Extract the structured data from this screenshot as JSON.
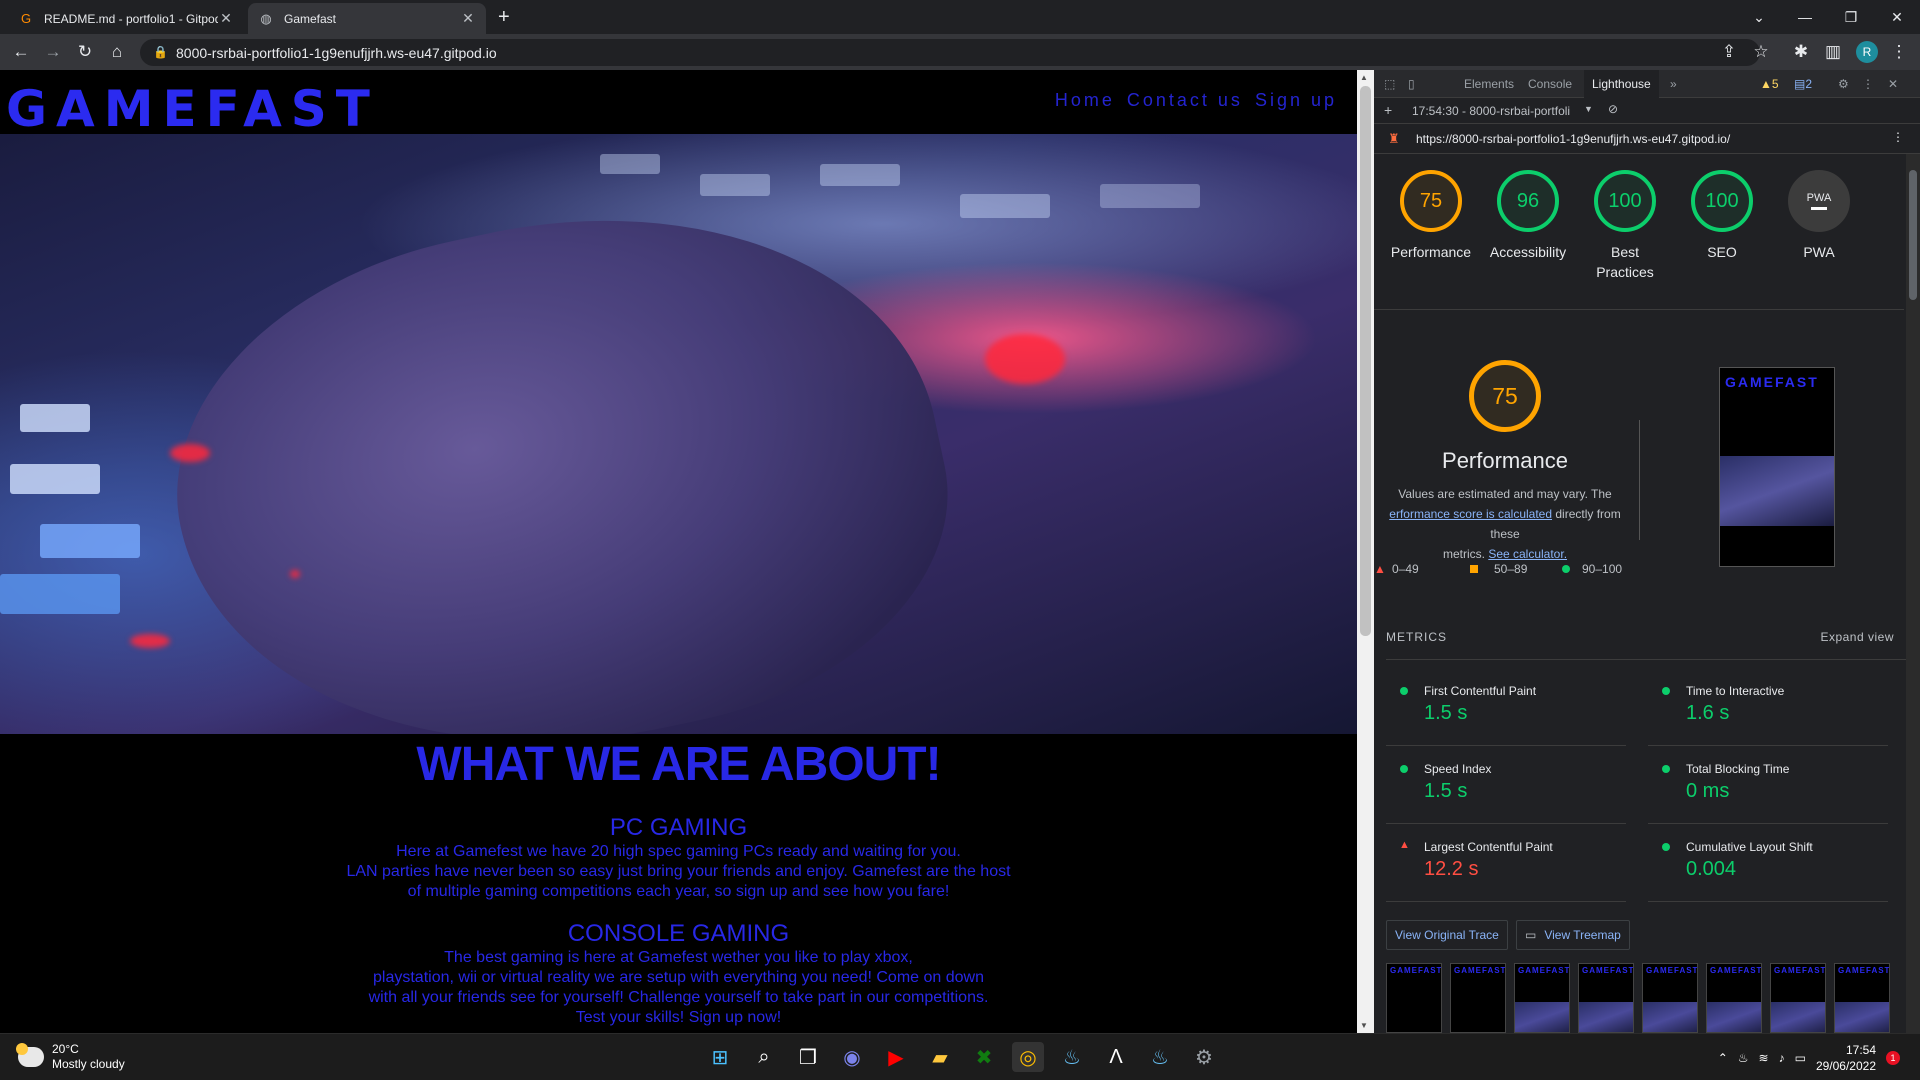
{
  "browser": {
    "tabs": [
      {
        "title": "README.md - portfolio1 - Gitpod",
        "active": false
      },
      {
        "title": "Gamefast",
        "active": true
      }
    ],
    "address": "8000-rsrbai-portfolio1-1g9enufjjrh.ws-eu47.gitpod.io",
    "profile_initial": "R"
  },
  "site": {
    "logo": "GAMEFAST",
    "nav": [
      "Home",
      "Contact us",
      "Sign up"
    ],
    "about_title": "WHAT WE ARE ABOUT!",
    "sections": [
      {
        "heading": "PC GAMING",
        "lines": [
          "Here at Gamefest we have 20 high spec gaming PCs ready and waiting for you.",
          "LAN parties have never been so easy just bring your friends and enjoy. Gamefest are the host",
          "of multiple gaming competitions each year, so sign up and see how you fare!"
        ]
      },
      {
        "heading": "CONSOLE GAMING",
        "lines": [
          "The best gaming is here at Gamefest wether you like to play xbox,",
          "playstation, wii or virtual reality we are setup with everything you need! Come on down",
          "with all your friends see for yourself! Challenge yourself to take part in our competitions.",
          "Test your skills! Sign up now!"
        ]
      }
    ],
    "accent_color": "#2828e6"
  },
  "devtools": {
    "tabs": [
      "Elements",
      "Console",
      "Lighthouse"
    ],
    "active_tab": "Lighthouse",
    "warnings": "5",
    "messages": "2",
    "report_selector": "17:54:30 - 8000-rsrbai-portfoli",
    "report_url": "https://8000-rsrbai-portfolio1-1g9enufjjrh.ws-eu47.gitpod.io/",
    "scores": [
      {
        "label": "Performance",
        "value": "75"
      },
      {
        "label": "Accessibility",
        "value": "96"
      },
      {
        "label": "Best Practices",
        "value": "100"
      },
      {
        "label": "SEO",
        "value": "100"
      },
      {
        "label": "PWA",
        "value": "PWA"
      }
    ],
    "performance": {
      "score": "75",
      "title": "Performance",
      "desc_1": "Values are estimated and may vary. The",
      "desc_link": "erformance score is calculated",
      "desc_2": "directly from these",
      "desc_3": "metrics.",
      "desc_link2": "See calculator.",
      "legend": [
        "0–49",
        "50–89",
        "90–100"
      ]
    },
    "metrics_label": "METRICS",
    "expand_label": "Expand view",
    "metrics": [
      {
        "name": "First Contentful Paint",
        "value": "1.5 s",
        "status": "good"
      },
      {
        "name": "Time to Interactive",
        "value": "1.6 s",
        "status": "good"
      },
      {
        "name": "Speed Index",
        "value": "1.5 s",
        "status": "good"
      },
      {
        "name": "Total Blocking Time",
        "value": "0 ms",
        "status": "good"
      },
      {
        "name": "Largest Contentful Paint",
        "value": "12.2 s",
        "status": "poor"
      },
      {
        "name": "Cumulative Layout Shift",
        "value": "0.004",
        "status": "good"
      }
    ],
    "buttons": [
      "View Original Trace",
      "View Treemap"
    ],
    "thumb_logo": "GAMEFAST"
  },
  "taskbar": {
    "temperature": "20°C",
    "weather": "Mostly cloudy",
    "time": "17:54",
    "date": "29/06/2022",
    "notifications": "1"
  }
}
